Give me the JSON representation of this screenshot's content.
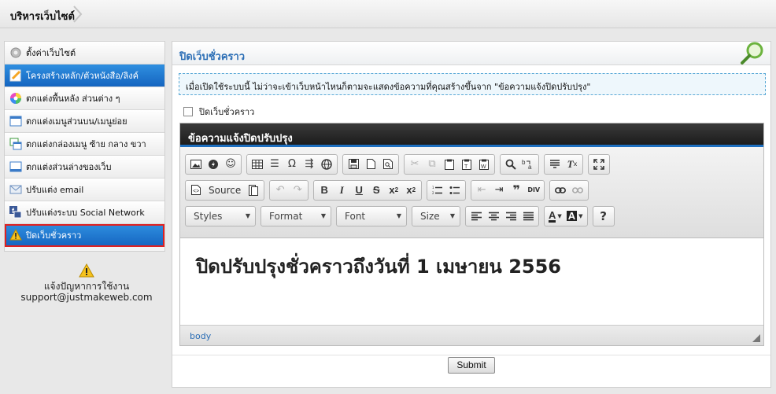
{
  "breadcrumb": {
    "label": "บริหารเว็บไซต์"
  },
  "sidebar": {
    "items": [
      {
        "label": "ตั้งค่าเว็บไซต์",
        "icon": "gear-icon"
      },
      {
        "label": "โครงสร้างหลัก/ตัวหนังสือ/ลิงค์",
        "icon": "edit-icon"
      },
      {
        "label": "ตกแต่งพื้นหลัง ส่วนต่าง ๆ",
        "icon": "color-wheel-icon"
      },
      {
        "label": "ตกแต่งเมนูส่วนบน/เมนูย่อย",
        "icon": "window-icon"
      },
      {
        "label": "ตกแต่งกล่องเมนู ซ้าย กลาง ขวา",
        "icon": "windows-icon"
      },
      {
        "label": "ตกแต่งส่วนล่างของเว็บ",
        "icon": "window-icon"
      },
      {
        "label": "ปรับแต่ง email",
        "icon": "mail-icon"
      },
      {
        "label": "ปรับแต่งระบบ Social Network",
        "icon": "facebook-icon"
      },
      {
        "label": "ปิดเว็บชั่วคราว",
        "icon": "warning-icon"
      }
    ]
  },
  "help": {
    "line1": "แจ้งปัญหาการใช้งาน",
    "line2": "support@justmakeweb.com"
  },
  "panel": {
    "title": "ปิดเว็บชั่วคราว",
    "notice": "เมื่อเปิดใช้ระบบนี้ ไม่ว่าจะเข้าเว็บหน้าไหนก็ตามจะแสดงข้อความที่คุณสร้างขึ้นจาก \"ข้อความแจ้งปิดปรับปรุง\"",
    "checkbox_label": "ปิดเว็บชั่วคราว",
    "checkbox_checked": false,
    "editor_title": "ข้อความแจ้งปิดปรับปรุง",
    "editor_content": "ปิดปรับปรุงชั่วคราวถึงวันที่ 1 เมษายน 2556",
    "source_label": "Source",
    "styles_label": "Styles",
    "format_label": "Format",
    "font_label": "Font",
    "size_label": "Size",
    "path_label": "body",
    "submit_label": "Submit"
  },
  "colors": {
    "accent": "#1565c0",
    "highlight_border": "#e02020",
    "title_blue": "#2a6db5"
  }
}
